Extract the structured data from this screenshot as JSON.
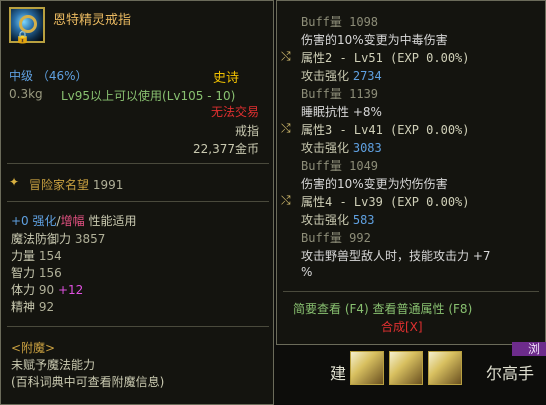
{
  "item": {
    "name": "恩特精灵戒指",
    "grade": "中级 （46%）",
    "rarity": "史诗",
    "weight": "0.3kg",
    "level_req": "Lv95以上可以使用(Lv105 - 10)",
    "trade": "无法交易",
    "type": "戒指",
    "price": "22,377金币"
  },
  "fame": {
    "label": "冒险家名望",
    "value": "1991"
  },
  "enhance": {
    "value": "+0",
    "label": "强化",
    "sep": "/",
    "amp": "增幅",
    "type": "性能适用"
  },
  "stats": [
    {
      "label": "魔法防御力",
      "value": "3857",
      "bonus": ""
    },
    {
      "label": "力量",
      "value": "154",
      "bonus": ""
    },
    {
      "label": "智力",
      "value": "156",
      "bonus": ""
    },
    {
      "label": "体力",
      "value": "90",
      "bonus": "+12"
    },
    {
      "label": "精神",
      "value": "92",
      "bonus": ""
    }
  ],
  "enchant": {
    "title": "<附魔>",
    "line1": "未赋予魔法能力",
    "line2": "(百科词典中可查看附魔信息)"
  },
  "right_panel": {
    "lines": [
      {
        "kind": "buff",
        "text": "Buff量 1098"
      },
      {
        "kind": "txt",
        "text": "伤害的10%变更为中毒伤害"
      },
      {
        "kind": "attr",
        "text": "属性2 - Lv51 (EXP 0.00%)"
      },
      {
        "kind": "atk",
        "label": "攻击强化",
        "value": "2734"
      },
      {
        "kind": "buff",
        "text": "Buff量 1139"
      },
      {
        "kind": "txt",
        "text": "睡眠抗性 +8%"
      },
      {
        "kind": "attr",
        "text": "属性3 - Lv41 (EXP 0.00%)"
      },
      {
        "kind": "atk",
        "label": "攻击强化",
        "value": "3083"
      },
      {
        "kind": "buff",
        "text": "Buff量 1049"
      },
      {
        "kind": "txt",
        "text": "伤害的10%变更为灼伤伤害"
      },
      {
        "kind": "attr",
        "text": "属性4 - Lv39 (EXP 0.00%)"
      },
      {
        "kind": "atk",
        "label": "攻击强化",
        "value": "583"
      },
      {
        "kind": "buff",
        "text": "Buff量 992"
      },
      {
        "kind": "txt",
        "text": "攻击野兽型敌人时，技能攻击力 +7"
      },
      {
        "kind": "txt",
        "text": "%"
      }
    ],
    "footer_link": "简要查看 (F4) 查看普通属性 (F8)",
    "footer_close": "合成[X]"
  },
  "background": {
    "text_left": "建",
    "text_right": "尔高手",
    "bar_text": "浏"
  },
  "colors": {
    "epic": "#f0c000",
    "enhance": "#5fa0e0",
    "untradeable": "#e03030",
    "bonus": "#e050e0"
  }
}
